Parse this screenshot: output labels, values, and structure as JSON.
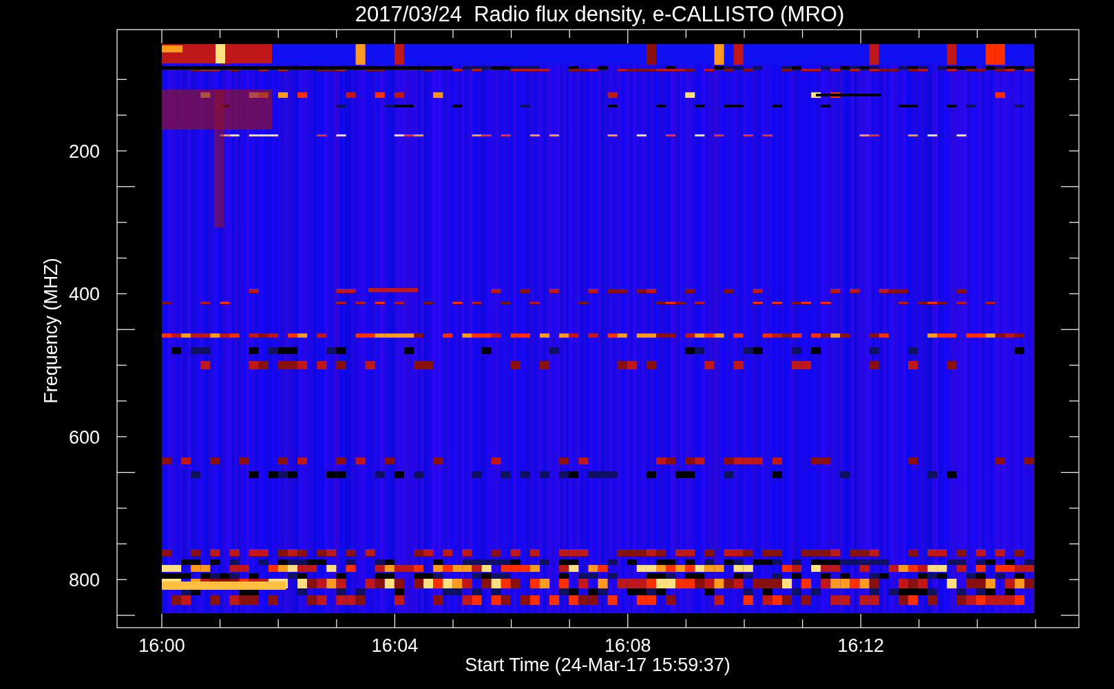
{
  "title": "2017/03/24  Radio flux density, e-CALLISTO (MRO)",
  "ylabel": "Frequency (MHZ)",
  "xlabel": "Start Time (24-Mar-17 15:59:37)",
  "xticks": [
    {
      "label": "16:00"
    },
    {
      "label": "16:04"
    },
    {
      "label": "16:08"
    },
    {
      "label": "16:12"
    }
  ],
  "yticks": [
    {
      "label": "200"
    },
    {
      "label": "400"
    },
    {
      "label": "600"
    },
    {
      "label": "800"
    }
  ]
}
